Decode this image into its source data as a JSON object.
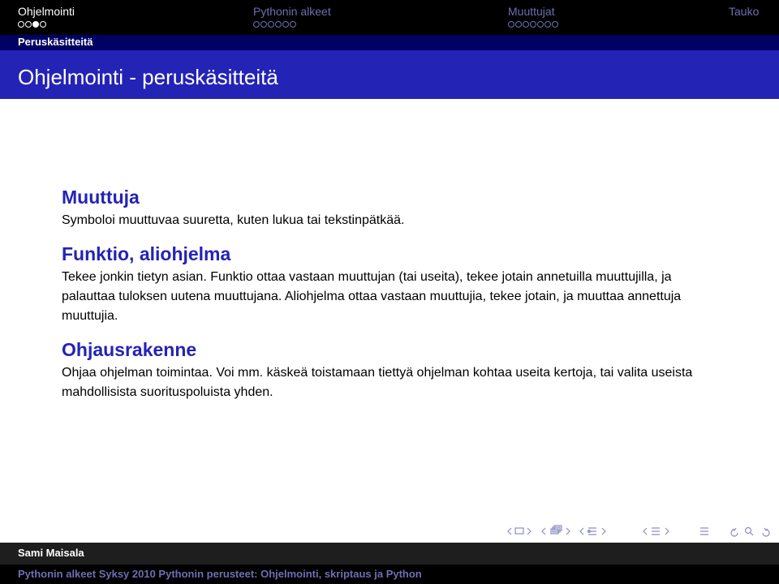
{
  "nav": {
    "sections": [
      {
        "label": "Ohjelmointi",
        "dots": 4,
        "current_dot": 3
      },
      {
        "label": "Pythonin alkeet",
        "dots": 6
      },
      {
        "label": "Muuttujat",
        "dots": 7
      },
      {
        "label": "Tauko",
        "dots": 0
      }
    ]
  },
  "subsection": "Peruskäsitteitä",
  "frame_title": "Ohjelmointi - peruskäsitteitä",
  "blocks": [
    {
      "title": "Muuttuja",
      "text": "Symboloi muuttuvaa suuretta, kuten lukua tai tekstinpätkää."
    },
    {
      "title": "Funktio, aliohjelma",
      "text": "Tekee jonkin tietyn asian. Funktio ottaa vastaan muuttujan (tai useita), tekee jotain annetuilla muuttujilla, ja palauttaa tuloksen uutena muuttujana. Aliohjelma ottaa vastaan muuttujia, tekee jotain, ja muuttaa annettuja muuttujia."
    },
    {
      "title": "Ohjausrakenne",
      "text": "Ohjaa ohjelman toimintaa. Voi mm. käskeä toistamaan tiettyä ohjelman kohtaa useita kertoja, tai valita useista mahdollisista suorituspoluista yhden."
    }
  ],
  "footer": {
    "author": "Sami Maisala",
    "title": "Pythonin alkeet Syksy 2010 Pythonin perusteet: Ohjelmointi, skriptaus ja Python"
  },
  "colors": {
    "nav_bg": "#000000",
    "frame_title_bg": "#2323b6",
    "block_title": "#2323b6",
    "inactive_nav": "#6e6eb2"
  }
}
